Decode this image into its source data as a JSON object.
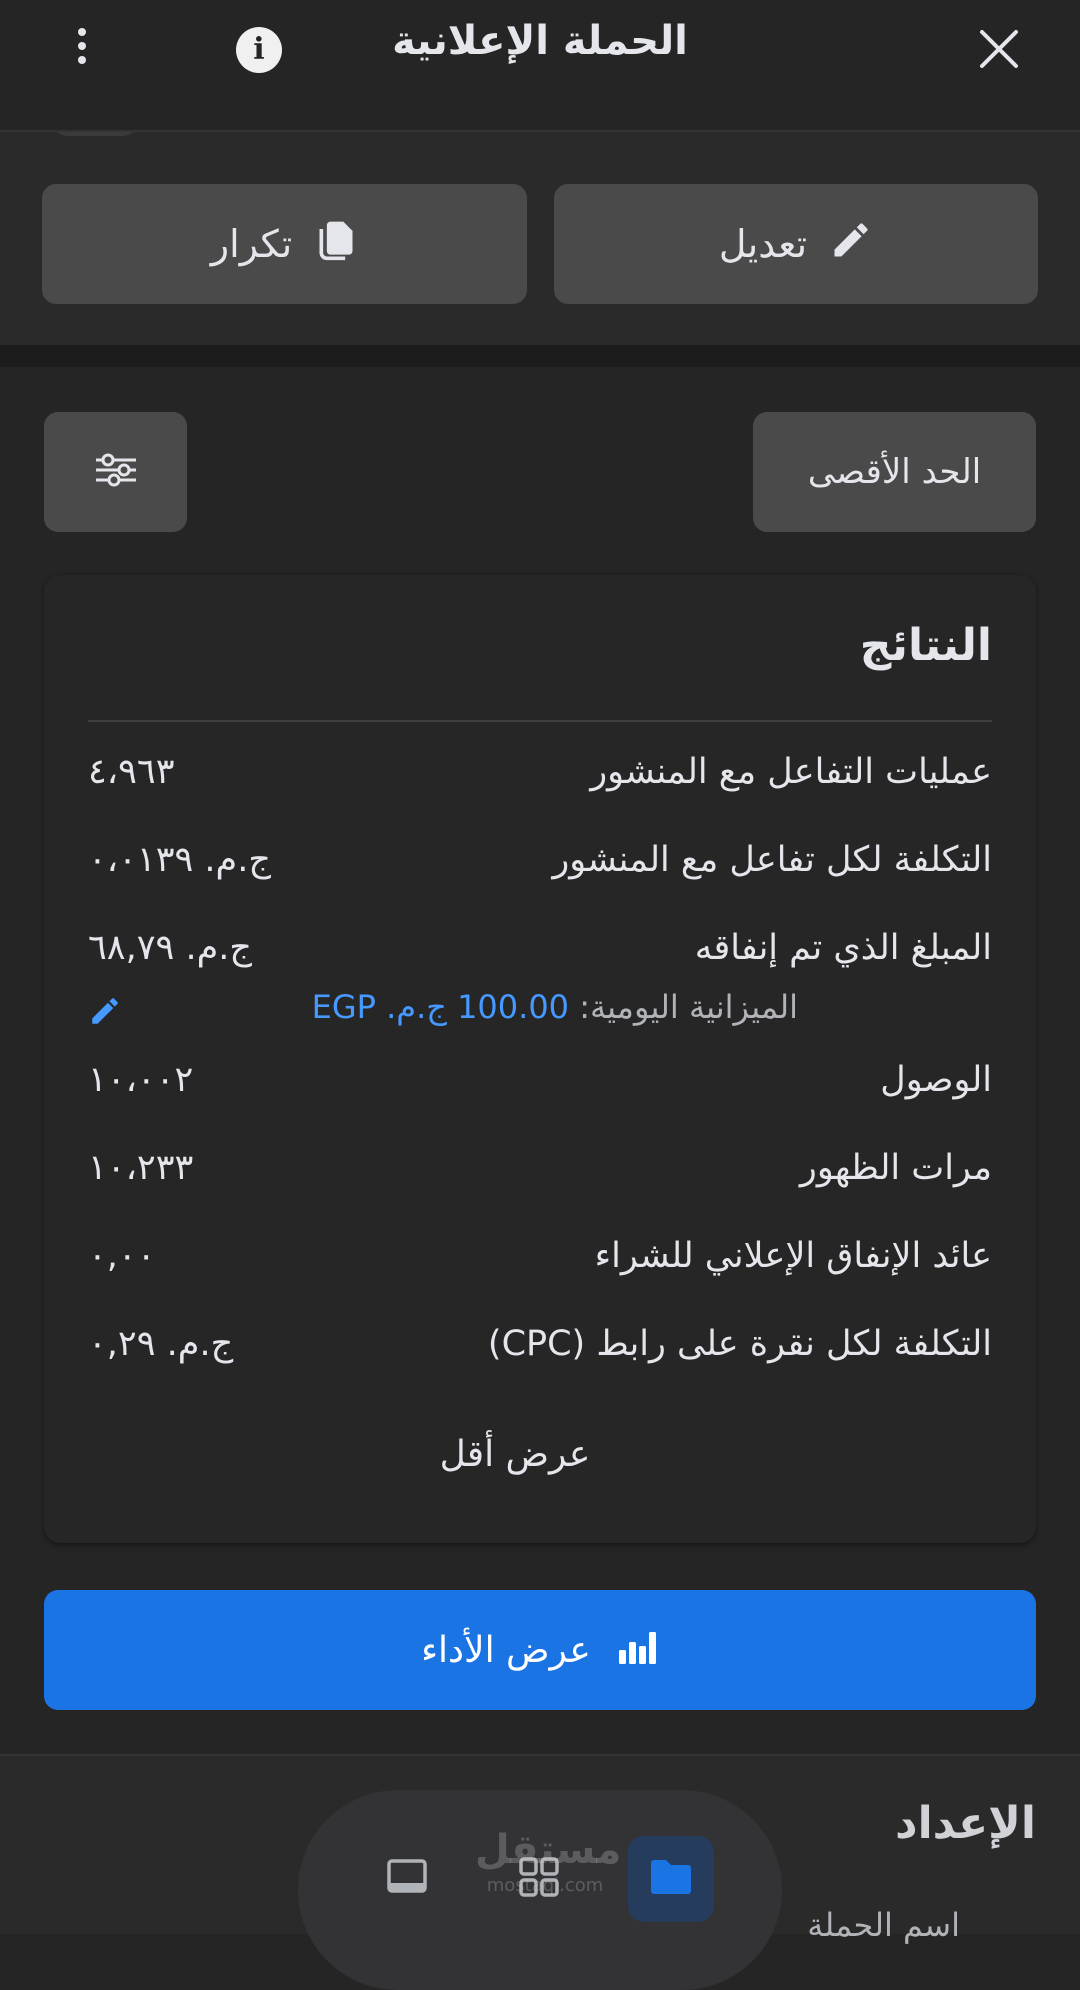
{
  "header": {
    "title": "الحملة الإعلانية",
    "info_label": "i"
  },
  "actions": {
    "edit_label": "تعديل",
    "duplicate_label": "تكرار"
  },
  "filter": {
    "max_label": "الحد الأقصى"
  },
  "results": {
    "title": "النتائج",
    "rows": [
      {
        "label": "عمليات  التفاعل مع المنشور",
        "value": "٤،٩٦٣"
      },
      {
        "label": "التكلفة لكل تفاعل مع المنشور",
        "value": "ج.م. ٠،٠١٣٩"
      },
      {
        "label": "المبلغ الذي تم إنفاقه",
        "value": "ج.م. ٦٨,٧٩"
      },
      {
        "label": "الوصول",
        "value": "١٠،٠٠٢"
      },
      {
        "label": "مرات الظهور",
        "value": "١٠،٢٣٣"
      },
      {
        "label": "عائد الإنفاق الإعلاني للشراء",
        "value": "٠,٠٠"
      },
      {
        "label": "التكلفة لكل نقرة على رابط (CPC)",
        "value": "ج.م. ٠,٢٩"
      }
    ],
    "budget_label": "الميزانية اليومية:",
    "budget_amount": "100.00 ج.م. EGP",
    "show_less": "عرض أقل"
  },
  "performance_button": "عرض الأداء",
  "setup": {
    "title": "الإعداد",
    "subtitle": "اسم الحملة"
  },
  "watermark": {
    "line1": "مستقل",
    "line2": "mostaql.com"
  },
  "colors": {
    "background": "#252526",
    "button": "#4a4a4b",
    "accent": "#1b74e4",
    "link": "#4599ff"
  },
  "icons": {
    "close": "close-icon",
    "info": "info-icon",
    "more": "more-vertical-icon",
    "edit": "pencil-icon",
    "duplicate": "copy-icon",
    "filter": "sliders-icon",
    "chart": "bar-chart-icon",
    "nav": [
      "tablet-icon",
      "grid-icon",
      "folder-icon"
    ]
  }
}
